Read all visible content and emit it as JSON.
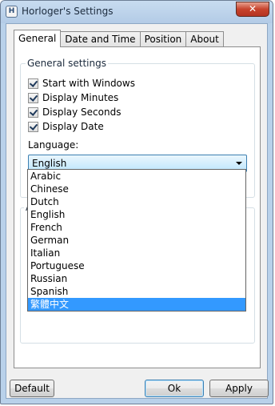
{
  "window": {
    "title": "Horloger's Settings",
    "close_label": "✕",
    "app_icon_glyph": "H"
  },
  "tabs": [
    {
      "label": "General",
      "active": true
    },
    {
      "label": "Date and Time",
      "active": false
    },
    {
      "label": "Position",
      "active": false
    },
    {
      "label": "About",
      "active": false
    }
  ],
  "general_settings": {
    "group_label": "General settings",
    "checkboxes": [
      {
        "label": "Start with Windows",
        "checked": true
      },
      {
        "label": "Display Minutes",
        "checked": true
      },
      {
        "label": "Display Seconds",
        "checked": true
      },
      {
        "label": "Display Date",
        "checked": true
      }
    ],
    "language_label": "Language:",
    "language_selected": "English"
  },
  "second_group": {
    "label_partial": "A"
  },
  "language_options": [
    "Arabic",
    "Chinese",
    "Dutch",
    "English",
    "French",
    "German",
    "Italian",
    "Portuguese",
    "Russian",
    "Spanish",
    "繁體中文"
  ],
  "highlighted_option": "繁體中文",
  "buttons": {
    "default": "Default",
    "ok": "Ok",
    "apply": "Apply"
  }
}
